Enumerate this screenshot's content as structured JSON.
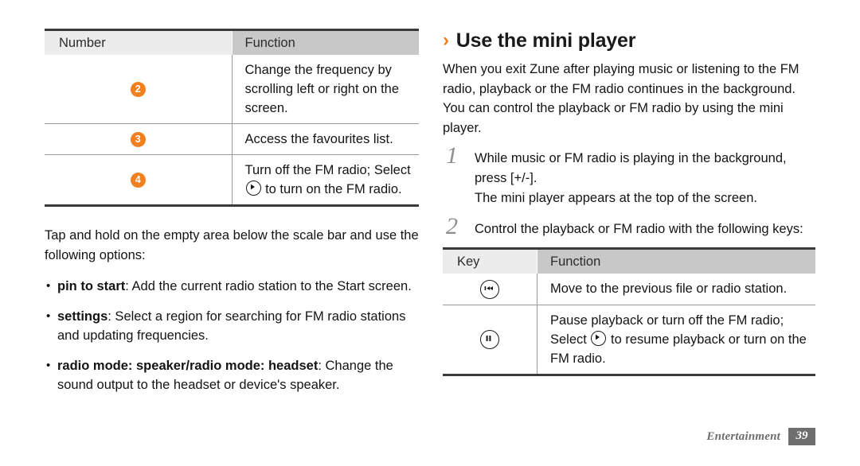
{
  "left": {
    "table": {
      "headers": [
        "Number",
        "Function"
      ],
      "rows": [
        {
          "number": "2",
          "function": "Change the frequency by scrolling left or right on the screen."
        },
        {
          "number": "3",
          "function": "Access the favourites list."
        },
        {
          "number": "4",
          "function_before": "Turn off the FM radio; Select ",
          "icon": "play-circle-icon",
          "function_after": " to turn on the FM radio."
        }
      ]
    },
    "intro": "Tap and hold on the empty area below the scale bar and use the following options:",
    "bullets": [
      {
        "term": "pin to start",
        "text": ": Add the current radio station to the Start screen."
      },
      {
        "term": "settings",
        "text": ": Select a region for searching for FM radio stations and updating frequencies."
      },
      {
        "term": "radio mode: speaker/radio mode: headset",
        "text": ": Change the sound output to the headset or device's speaker."
      }
    ]
  },
  "right": {
    "heading": "Use the mini player",
    "heading_chevron": "›",
    "intro": "When you exit Zune after playing music or listening to the FM radio, playback or the FM radio continues in the background. You can control the playback or FM radio by using the mini player.",
    "steps": [
      {
        "num": "1",
        "text": "While music or FM radio is playing in the background, press [+/-].",
        "sub": "The mini player appears at the top of the screen."
      },
      {
        "num": "2",
        "text": "Control the playback or FM radio with the following keys:"
      }
    ],
    "table": {
      "headers": [
        "Key",
        "Function"
      ],
      "rows": [
        {
          "key_icon": "previous-track-circle-icon",
          "function": "Move to the previous file or radio station."
        },
        {
          "key_icon": "pause-circle-icon",
          "function_before": "Pause playback or turn off the FM radio; Select ",
          "icon": "play-circle-icon",
          "function_after": " to resume playback or turn on the FM radio."
        }
      ]
    }
  },
  "footer": {
    "label": "Entertainment",
    "page": "39"
  },
  "colors": {
    "accent_orange": "#F08020",
    "header_key_bg": "#ECECEC",
    "header_function_bg": "#C8C8C8",
    "rule_dark": "#3B3B3B",
    "footer_gray": "#6E6E6E"
  }
}
